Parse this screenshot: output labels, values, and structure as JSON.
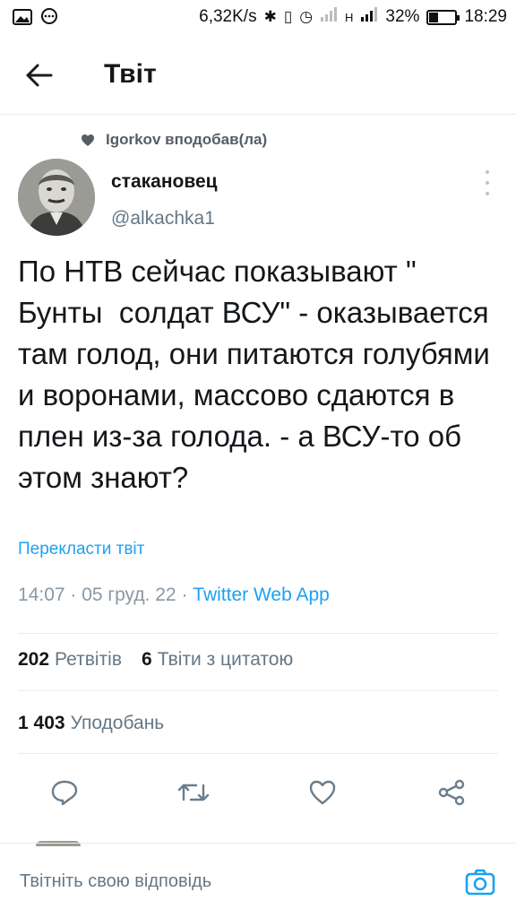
{
  "status_bar": {
    "net_speed": "6,32K/s",
    "signal_label": "H",
    "battery_percent_text": "32%",
    "battery_level": 0.32,
    "time": "18:29",
    "icons": [
      "image-icon",
      "chat-bubble-icon",
      "bluetooth-icon",
      "vibrate-icon",
      "alarm-icon",
      "signal-icon",
      "battery-icon"
    ]
  },
  "header": {
    "title": "Твіт",
    "back_icon": "arrow-left-icon"
  },
  "tweet": {
    "social_context": "Igorkov вподобав(ла)",
    "author_name": "стакановец",
    "author_handle": "@alkachka1",
    "text": "По НТВ сейчас показывают \" Бунты  солдат ВСУ\" - оказывается там голод, они питаются голубями и воронами, массово сдаются в плен из-за голода. - а ВСУ-то об этом знают?",
    "translate_label": "Перекласти твіт",
    "time": "14:07",
    "date": "05 груд. 22",
    "source": "Twitter Web App",
    "retweets_count": "202",
    "retweets_label": "Ретвітів",
    "quotes_count": "6",
    "quotes_label": "Твіти з цитатою",
    "likes_count": "1 403",
    "likes_label": "Уподобань"
  },
  "actions": [
    "reply-icon",
    "retweet-icon",
    "like-icon",
    "share-icon"
  ],
  "reply_bar": {
    "placeholder": "Твітніть свою відповідь",
    "camera_icon": "camera-icon"
  },
  "colors": {
    "accent": "#1da1f2",
    "text": "#14171a",
    "secondary": "#657786",
    "divider": "#e6ecf0"
  }
}
